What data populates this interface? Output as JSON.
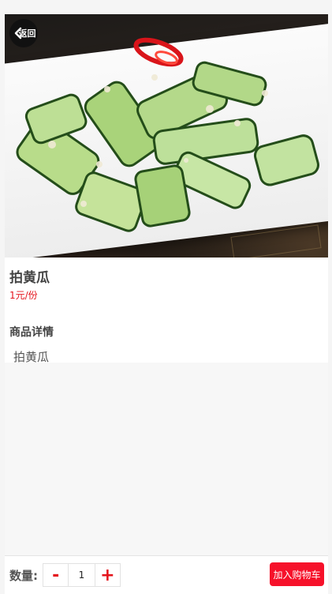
{
  "header": {
    "back_label": "返回"
  },
  "product": {
    "image_alt": "拍黄瓜",
    "name": "拍黄瓜",
    "price": "1元/份"
  },
  "details": {
    "heading": "商品详情",
    "body": "拍黄瓜"
  },
  "footer": {
    "quantity_label": "数量:",
    "decrement": "-",
    "quantity_value": "1",
    "increment": "+",
    "add_to_cart": "加入购物车"
  },
  "colors": {
    "accent": "#e4141c",
    "cart_button": "#f6112a"
  },
  "icons": {
    "back": "chevron-left-icon"
  }
}
